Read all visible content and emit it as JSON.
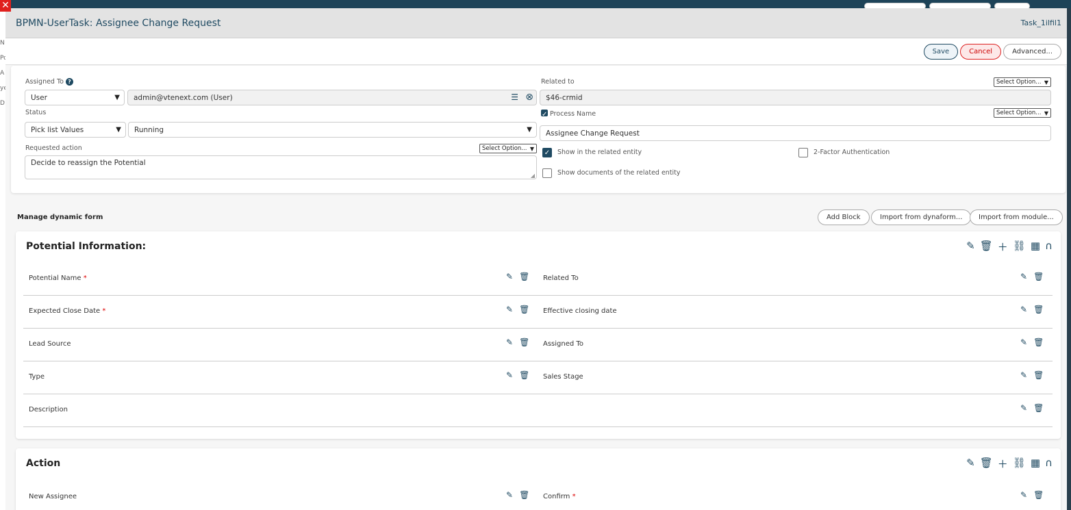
{
  "background": {
    "left_texts": [
      "N",
      "Po",
      "A",
      "ye",
      "D"
    ]
  },
  "modal": {
    "title": "BPMN-UserTask: Assignee Change Request",
    "task_id": "Task_1ilfil1"
  },
  "toolbar": {
    "save_label": "Save",
    "cancel_label": "Cancel",
    "advanced_label": "Advanced..."
  },
  "form": {
    "assigned_to_label": "Assigned To",
    "assigned_type": "User",
    "assigned_value": "admin@vtenext.com (User)",
    "status_label": "Status",
    "status_type": "Pick list Values",
    "status_value": "Running",
    "requested_action_label": "Requested action",
    "requested_action_select": "Select Option...",
    "requested_action_value": "Decide to reassign the Potential",
    "related_to_label": "Related to",
    "related_to_select": "Select Option...",
    "related_to_value": "$46-crmid",
    "process_name_label": "Process Name",
    "process_name_select": "Select Option...",
    "process_name_value": "Assignee Change Request",
    "show_related_label": "Show in the related entity",
    "show_docs_label": "Show documents of the related entity",
    "two_factor_label": "2-Factor Authentication"
  },
  "dynamic_form": {
    "title": "Manage dynamic form",
    "add_block_label": "Add Block",
    "import_dynaform_label": "Import from dynaform...",
    "import_module_label": "Import from module..."
  },
  "blocks": [
    {
      "title": "Potential Information:",
      "rows": [
        {
          "left": "Potential Name",
          "left_req": "*",
          "right": "Related To",
          "right_req": ""
        },
        {
          "left": "Expected Close Date",
          "left_req": "*",
          "right": "Effective closing date",
          "right_req": ""
        },
        {
          "left": "Lead Source",
          "left_req": "",
          "right": "Assigned To",
          "right_req": ""
        },
        {
          "left": "Type",
          "left_req": "",
          "right": "Sales Stage",
          "right_req": ""
        },
        {
          "left": "Description",
          "left_req": "",
          "right": "",
          "right_req": ""
        }
      ]
    },
    {
      "title": "Action",
      "rows": [
        {
          "left": "New Assignee",
          "left_req": "",
          "right": "Confirm",
          "right_req": "*"
        }
      ]
    }
  ],
  "colors": {
    "accent": "#1f4a62",
    "cancel": "#dd2222",
    "required": "#dd0000"
  }
}
